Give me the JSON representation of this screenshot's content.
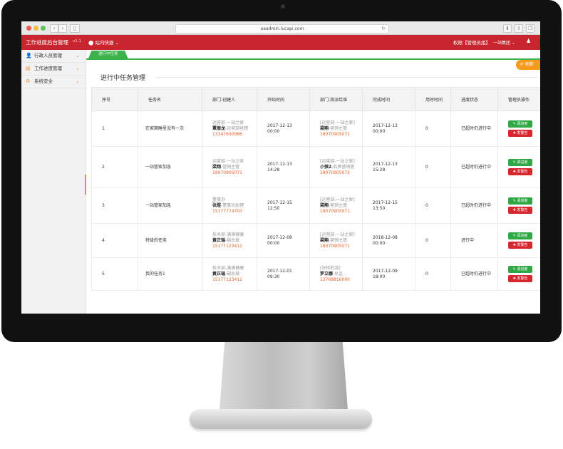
{
  "browser": {
    "url": "oaadmin.lucapi.com"
  },
  "header": {
    "title": "工作进度后台管理",
    "version": "v1.1",
    "nav_shortcut": "站内快捷",
    "permission": "权限【管理员组】",
    "group": "一站集团"
  },
  "sidebar": {
    "items": [
      {
        "label": "行政人员管理"
      },
      {
        "label": "工作进度管理"
      },
      {
        "label": "系统安全"
      }
    ]
  },
  "tabs": [
    {
      "label": "进行中任务"
    }
  ],
  "refresh_label": "刷新",
  "page_title": "进行中任务管理",
  "table": {
    "headers": [
      "序号",
      "任务名",
      "部门-创建人",
      "开始时间",
      "部门-指派给谁",
      "完成时间",
      "用时时间",
      "进度状态",
      "管理员操作"
    ],
    "actions": {
      "edit": "调进度",
      "send": "发警告"
    },
    "rows": [
      {
        "no": "1",
        "task": "在家窝睡里没有一次",
        "creator_dept": "运营部-一站之家",
        "creator_name": "覃振龙",
        "creator_title": "-运营部经理",
        "creator_phone": "13347600986",
        "start_date": "2017-12-13",
        "start_time": "00:00",
        "assignee_dept": "[运营部-一站之家]",
        "assignee_name": "梁翔",
        "assignee_title": "-营销主管",
        "assignee_phone": "18070905071",
        "end_date": "2017-12-13",
        "end_time": "00:00",
        "used": "0",
        "status": "已超时仍进行中"
      },
      {
        "no": "2",
        "task": "一站管家加急",
        "creator_dept": "运营部-一站之家",
        "creator_name": "梁翔",
        "creator_title": "-营销主管",
        "creator_phone": "18070905071",
        "start_date": "2017-12-13",
        "start_time": "14:28",
        "assignee_dept": "[运营部-一站之家]",
        "assignee_name": "小張2",
        "assignee_title": "-品牌营销管",
        "assignee_phone": "18070905072",
        "end_date": "2017-12-13",
        "end_time": "15:28",
        "used": "0",
        "status": "已超时仍进行中"
      },
      {
        "no": "3",
        "task": "一站管家加急",
        "creator_dept": "董事办",
        "creator_name": "张煜",
        "creator_title": "-董事长助理",
        "creator_phone": "15177774703",
        "start_date": "2017-12-15",
        "start_time": "12:50",
        "assignee_dept": "[运营部-一站之家]",
        "assignee_name": "梁翔",
        "assignee_title": "-营销主管",
        "assignee_phone": "18070905071",
        "end_date": "2017-12-15",
        "end_time": "13:50",
        "used": "0",
        "status": "已超时仍进行中"
      },
      {
        "no": "4",
        "task": "特级的任务",
        "creator_dept": "技术部-满满健康",
        "creator_name": "黄正瑞",
        "creator_title": "-副总裁",
        "creator_phone": "15177123412",
        "start_date": "2017-12-08",
        "start_time": "00:00",
        "assignee_dept": "[运营部-一站之家]",
        "assignee_name": "梁翔",
        "assignee_title": "-营销主管",
        "assignee_phone": "18070905071",
        "end_date": "2018-12-08",
        "end_time": "00:00",
        "used": "0",
        "status": "进行中"
      },
      {
        "no": "5",
        "task": "我的任务1",
        "creator_dept": "技术部-满满健康",
        "creator_name": "黄正瑞",
        "creator_title": "-副总裁",
        "creator_phone": "15177123412",
        "start_date": "2017-12-01",
        "start_time": "09:30",
        "assignee_dept": "[好样的我]",
        "assignee_name": "罗立娜",
        "assignee_title": "-总监",
        "assignee_phone": "13768816000",
        "end_date": "2017-12-09",
        "end_time": "18:00",
        "used": "0",
        "status": "已超时仍进行中"
      }
    ]
  }
}
